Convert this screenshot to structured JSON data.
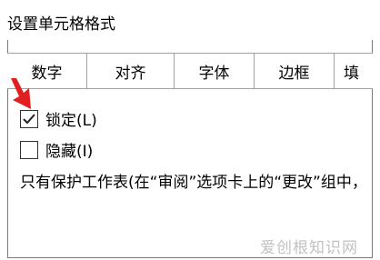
{
  "dialog": {
    "title": "设置单元格格式"
  },
  "tabs": [
    {
      "label": "数字"
    },
    {
      "label": "对齐"
    },
    {
      "label": "字体"
    },
    {
      "label": "边框"
    },
    {
      "label": "填"
    }
  ],
  "protection": {
    "lock": {
      "label": "锁定(L)",
      "checked": true
    },
    "hide": {
      "label": "隐藏(I)",
      "checked": false
    },
    "note": "只有保护工作表(在“审阅”选项卡上的“更改”组中，"
  },
  "watermark": "爱创根知识网",
  "colors": {
    "arrow": "#e02020",
    "border": "#a0a0a0"
  }
}
